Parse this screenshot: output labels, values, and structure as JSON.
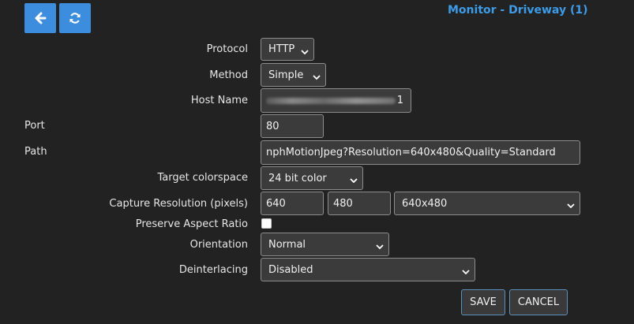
{
  "header": {
    "title": "Monitor - Driveway (1)",
    "back_icon": "arrow-left-icon",
    "refresh_icon": "refresh-icon",
    "accent": "#3c8dde"
  },
  "form": {
    "protocol": {
      "label": "Protocol",
      "value": "HTTP"
    },
    "method": {
      "label": "Method",
      "value": "Simple"
    },
    "host_name": {
      "label": "Host Name",
      "value_suffix": "1"
    },
    "port": {
      "label": "Port",
      "value": "80"
    },
    "path": {
      "label": "Path",
      "value": "nphMotionJpeg?Resolution=640x480&Quality=Standard"
    },
    "target_colorspace": {
      "label": "Target colorspace",
      "value": "24 bit color"
    },
    "capture_resolution": {
      "label": "Capture Resolution (pixels)",
      "width": "640",
      "height": "480",
      "preset": "640x480"
    },
    "preserve_aspect_ratio": {
      "label": "Preserve Aspect Ratio",
      "checked": false
    },
    "orientation": {
      "label": "Orientation",
      "value": "Normal"
    },
    "deinterlacing": {
      "label": "Deinterlacing",
      "value": "Disabled"
    }
  },
  "actions": {
    "save_label": "SAVE",
    "cancel_label": "CANCEL"
  }
}
